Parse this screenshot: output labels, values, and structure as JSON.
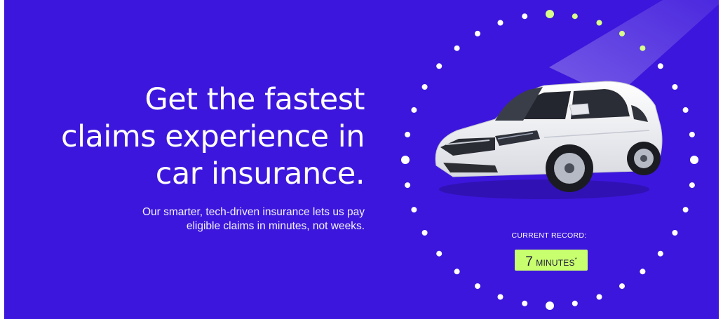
{
  "colors": {
    "background": "#3c16dc",
    "dot": "#ffffff",
    "dot_active": "#d7ff8a",
    "badge": "#c8ff6e",
    "car_body": "#f4f5f7"
  },
  "hero": {
    "headline_lines": [
      "Get the fastest",
      "claims experience in",
      "car insurance."
    ],
    "subtext_lines": [
      "Our smarter, tech-driven insurance lets us pay",
      "eligible claims in minutes, not weeks."
    ]
  },
  "record": {
    "label": "CURRENT RECORD:",
    "value": "7",
    "unit": "MINUTES",
    "footnote_mark": "*"
  },
  "graphic": {
    "illustration": "white-suv-car",
    "dot_count": 36,
    "active_dot_count": 5
  }
}
